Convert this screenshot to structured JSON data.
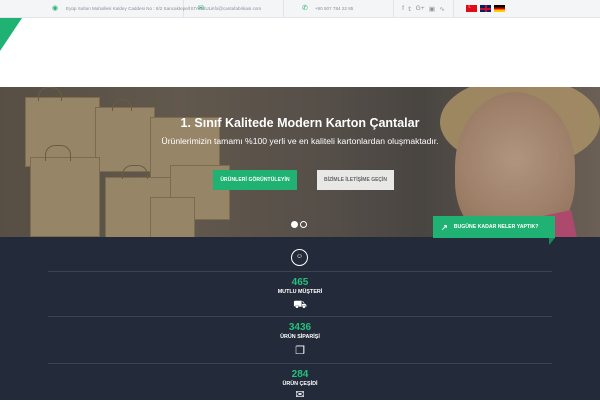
{
  "topbar": {
    "address": "Eyüp Sultan Mahallesi Kaldey Caddesi No : 8/2 Sancaktepe/İSTANBUL",
    "email": "info@cantafabrikasi.com",
    "phone": "+90 507 784 22 85",
    "social_icons": [
      "facebook-icon",
      "twitter-icon",
      "google-plus-icon",
      "instagram-icon",
      "rss-icon"
    ],
    "languages": [
      "tr",
      "en",
      "de"
    ]
  },
  "hero": {
    "title": "1. Sınıf Kalitede Modern Karton Çantalar",
    "subtitle": "Ürünlerimizin tamamı %100 yerli ve en kaliteli kartonlardan oluşmaktadır.",
    "primary_button": "ÜRÜNLERİ GÖRÜNTÜLEYİN",
    "secondary_button": "BİZİMLE İLETİŞİME GEÇİN",
    "slides": 2,
    "active_slide": 1
  },
  "achievements_tab": {
    "label": "BUGÜNE KADAR NELER YAPTIK?"
  },
  "stats": [
    {
      "value": "465",
      "label": "MUTLU MÜŞTERİ",
      "icon": "truck-icon"
    },
    {
      "value": "3436",
      "label": "ÜRÜN SİPARİŞİ",
      "icon": "box-icon"
    },
    {
      "value": "284",
      "label": "ÜRÜN ÇEŞİDİ",
      "icon": "tag-icon"
    }
  ],
  "colors": {
    "accent": "#1fb272",
    "dark_section": "#232a3a",
    "stat_number": "#22c07b"
  }
}
